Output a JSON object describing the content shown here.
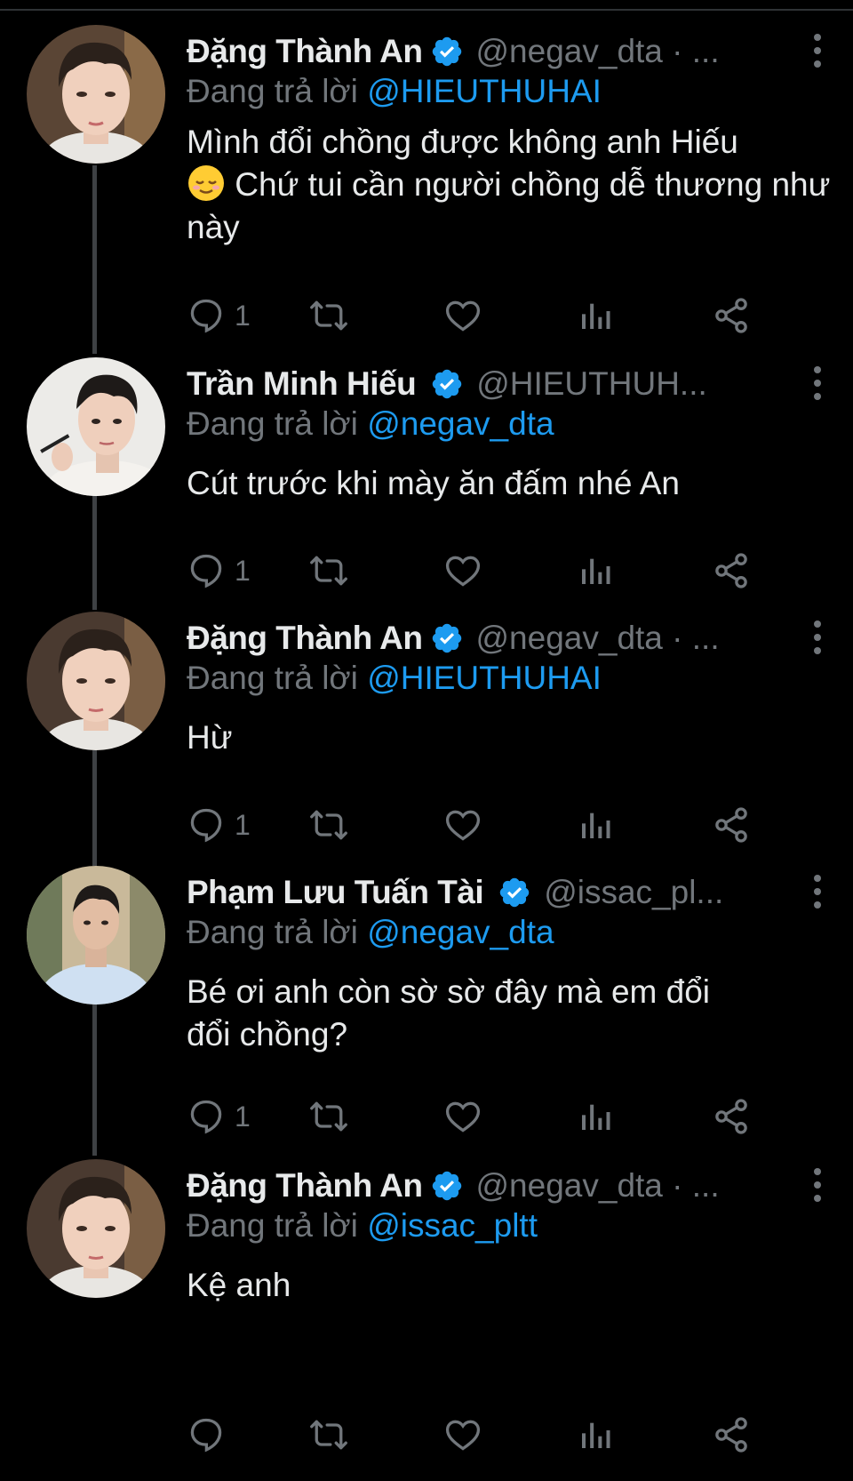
{
  "colors": {
    "background": "#000000",
    "text": "#e7e9ea",
    "muted": "#71767b",
    "mention": "#1d9bf0",
    "verified": "#1d9bf0",
    "thread_line": "#3e4144"
  },
  "reply_prefix": "Đang trả lời",
  "tweets": [
    {
      "name": "Đặng Thành An",
      "handle": "@negav_dta · ...",
      "reply_to": "@HIEUTHUHAI",
      "text_1": "Mình đổi chồng được không anh Hiếu",
      "emoji": "relieved-face",
      "text_2": " Chứ tui cần người chồng dễ thương như này",
      "reply_count": "1"
    },
    {
      "name": "Trần Minh Hiếu",
      "handle": "@HIEUTHUH...",
      "reply_to": "@negav_dta",
      "text": "Cút trước khi mày ăn đấm nhé An",
      "reply_count": "1"
    },
    {
      "name": "Đặng Thành An",
      "handle": "@negav_dta · ...",
      "reply_to": "@HIEUTHUHAI",
      "text": "Hừ",
      "reply_count": "1"
    },
    {
      "name": "Phạm Lưu Tuấn Tài",
      "handle": "@issac_pl...",
      "reply_to": "@negav_dta",
      "text": "Bé ơi anh còn sờ sờ đây mà em đổi đổi chồng?",
      "reply_count": "1"
    },
    {
      "name": "Đặng Thành An",
      "handle": "@negav_dta · ...",
      "reply_to": "@issac_pltt",
      "text": "Kệ anh",
      "reply_count": ""
    }
  ],
  "icons": [
    "reply-icon",
    "retweet-icon",
    "like-icon",
    "views-icon",
    "share-icon",
    "more-icon",
    "verified-badge-icon"
  ]
}
